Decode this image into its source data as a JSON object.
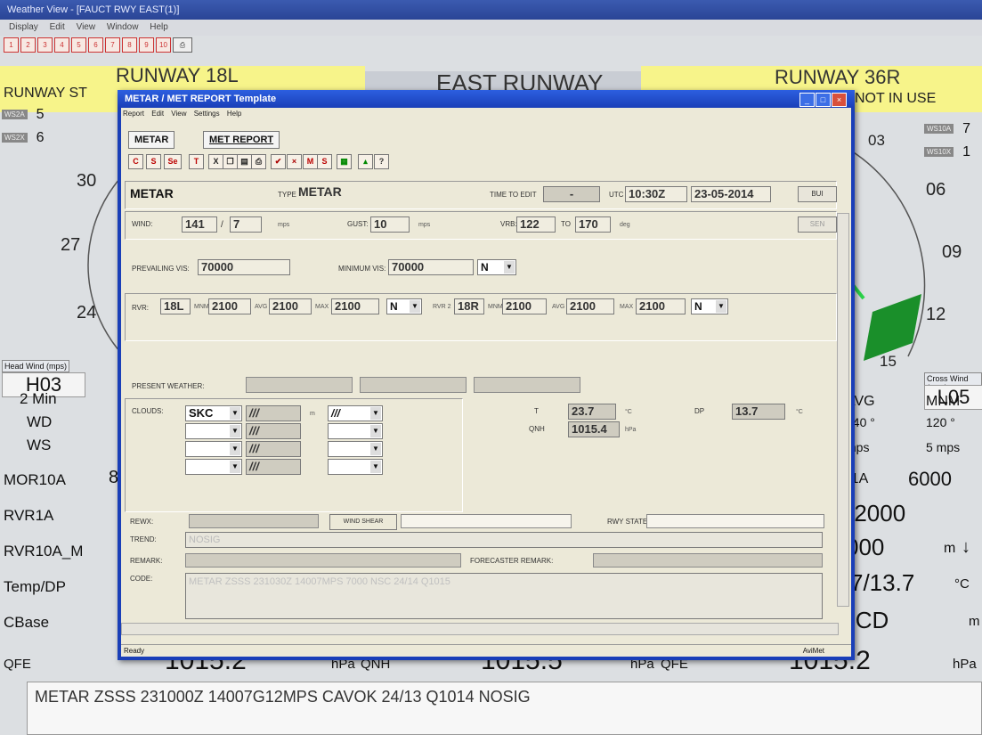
{
  "background": {
    "title": "Weather View - [FAUCT RWY EAST(1)]",
    "menu": [
      "Display",
      "Edit",
      "View",
      "Window",
      "Help"
    ],
    "toolbar": [
      "1",
      "2",
      "3",
      "4",
      "5",
      "6",
      "7",
      "8",
      "9",
      "10"
    ],
    "runway_left": "RUNWAY 18L",
    "runway_left_status": "RUNWAY ST",
    "runway_center": "EAST RUNWAY",
    "runway_right": "RUNWAY 36R",
    "runway_right_status": "NOT IN USE",
    "ws_left": [
      {
        "tag": "WS2A",
        "value": "5"
      },
      {
        "tag": "WS2X",
        "value": "6"
      }
    ],
    "ws_right": [
      {
        "tag": "WS10A",
        "value": "7"
      },
      {
        "tag": "WS10X",
        "value": "1"
      }
    ],
    "dial_left": [
      "30",
      "27",
      "24"
    ],
    "dial_right": [
      "03",
      "06",
      "09",
      "12",
      "15"
    ],
    "head_wind_label": "Head Wind (mps)",
    "head_wind_value": "H03",
    "cross_wind_label": "Cross Wind (mps)",
    "cross_wind_value": "L05",
    "two_min": "2 Min",
    "wd": "WD",
    "ws": "WS",
    "avg_header": "AVG",
    "mnm_header": "MNM",
    "avg_wd": "140 °",
    "mnm_wd": "120 °",
    "avg_ws": "mps",
    "mnm_ws": "5 mps",
    "mor10a_label": "MOR10A",
    "mor10a_value": "8",
    "mor_right_label": "S1A",
    "mor_right_value": "6000",
    "rvr1a_label": "RVR1A",
    "rvr1a_right": "P2000",
    "rvr10a_label": "RVR10A_M",
    "rvr10a_right": "000",
    "rvr10a_unit": "m",
    "temp_label": "Temp/DP",
    "temp_right": "7/13.7",
    "temp_unit": "°C",
    "cbase_label": "CBase",
    "cbase_right": "NCD",
    "cbase_unit": "m",
    "qfe_label": "QFE",
    "qfe_value": "1015.2",
    "qnh_label": "QNH",
    "qnh_value": "1015.5",
    "qfe2_label": "QFE",
    "qfe2_value": "1015.2",
    "hpa": "hPa",
    "metar_line": "METAR ZSSS 231000Z 14007G12MPS CAVOK 24/13 Q1014 NOSIG"
  },
  "dialog": {
    "title": "METAR / MET REPORT Template",
    "menu": [
      "Report",
      "Edit",
      "View",
      "Settings",
      "Help"
    ],
    "tabs": [
      "METAR",
      "MET REPORT"
    ],
    "tools": [
      "C",
      "S",
      "Se",
      "T",
      "X",
      "",
      "",
      "",
      "",
      "",
      "M",
      "S",
      "",
      "",
      "?"
    ],
    "header": {
      "report": "METAR",
      "type_label": "TYPE",
      "type_value": "METAR",
      "time_to_edit_label": "TIME TO EDIT",
      "time_to_edit_value": "-",
      "utc_label": "UTC",
      "utc_value": "10:30Z",
      "date_value": "23-05-2014",
      "build_button": "BUI",
      "send_button": "SEN"
    },
    "wind": {
      "label": "WIND:",
      "dir": "141",
      "speed": "7",
      "unit": "mps",
      "gust_label": "GUST:",
      "gust": "10",
      "gust_unit": "mps",
      "vrb_label": "VRB:",
      "vrb_from": "122",
      "to_label": "TO",
      "vrb_to": "170",
      "deg": "deg"
    },
    "vis": {
      "prevailing_label": "PREVAILING VIS:",
      "prevailing": "70000",
      "minimum_label": "MINIMUM VIS:",
      "minimum": "70000",
      "direction": "N"
    },
    "rvr": {
      "label": "RVR:",
      "rwy1": "18L",
      "mnm_label": "MNM",
      "mnm1": "2100",
      "avg_label": "AVG",
      "avg1": "2100",
      "max_label": "MAX",
      "max1": "2100",
      "trend1": "N",
      "rvr2_label": "RVR 2",
      "rwy2": "18R",
      "mnm2": "2100",
      "avg2": "2100",
      "max2": "2100",
      "trend2": "N"
    },
    "present_weather_label": "PRESENT WEATHER:",
    "clouds": {
      "label": "CLOUDS:",
      "amount": "SKC",
      "height": "///",
      "unit": "m",
      "type": "///",
      "rows_blank": [
        "///",
        "///",
        "///"
      ]
    },
    "temp": {
      "t_label": "T",
      "t_value": "23.7",
      "t_unit": "°C",
      "dp_label": "DP",
      "dp_value": "13.7",
      "dp_unit": "°C",
      "qnh_label": "QNH",
      "qnh_value": "1015.4",
      "qnh_unit": "hPa"
    },
    "rews_label": "REWX:",
    "wind_shear_button": "WIND SHEAR",
    "rwy_state_label": "RWY STATE:",
    "trend_label": "TREND:",
    "trend_value": "NOSIG",
    "remark_label": "REMARK:",
    "forecaster_label": "FORECASTER REMARK:",
    "code_label": "CODE:",
    "code_value": "METAR ZSSS 231030Z 14007MPS 7000 NSC 24/14 Q1015",
    "status": "Ready",
    "status_right": "AviMet"
  }
}
